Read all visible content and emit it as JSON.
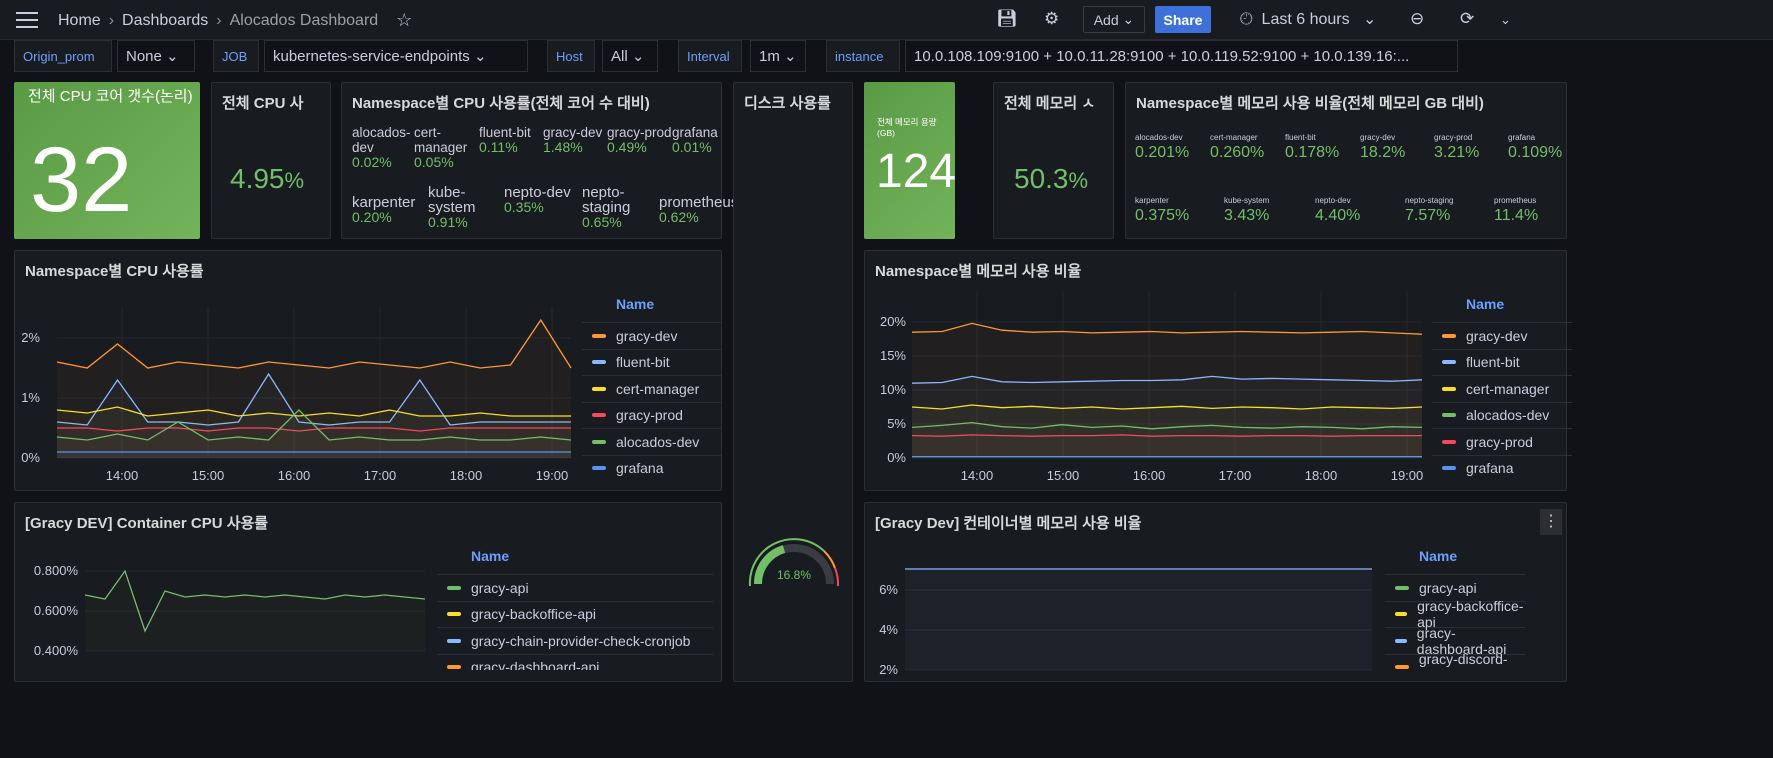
{
  "header": {
    "crumbs": [
      "Home",
      "Dashboards",
      "Alocados Dashboard"
    ],
    "add": "Add",
    "share": "Share",
    "time_range": "Last 6 hours"
  },
  "variables": [
    {
      "label": "Origin_prom",
      "value": "None"
    },
    {
      "label": "JOB",
      "value": "kubernetes-service-endpoints"
    },
    {
      "label": "Host",
      "value": "All"
    },
    {
      "label": "Interval",
      "value": "1m"
    },
    {
      "label": "instance",
      "value": "10.0.108.109:9100 + 10.0.11.28:9100 + 10.0.119.52:9100 + 10.0.139.16:..."
    }
  ],
  "stats": {
    "cpu_cores": {
      "title": "전체 CPU 코어 갯수(논리)",
      "value": "32"
    },
    "cpu_usage": {
      "title": "전체 CPU 사",
      "value": "4.95",
      "unit": "%"
    },
    "disk": {
      "title": "디스크 사용률",
      "gauge_value": "16.8%",
      "gauge_fraction": 0.168
    },
    "mem_total": {
      "title": "전체 메모리 용량 (GB)",
      "value": "124"
    },
    "mem_usage": {
      "title": "전체 메모리 ㅅ",
      "value": "50.3",
      "unit": "%"
    }
  },
  "ns_cpu": {
    "title": "Namespace별 CPU 사용률(전체 코어 수 대비)",
    "items": [
      {
        "name": "alocados-dev",
        "value": "0.02%"
      },
      {
        "name": "cert-manager",
        "value": "0.05%"
      },
      {
        "name": "fluent-bit",
        "value": "0.11%"
      },
      {
        "name": "gracy-dev",
        "value": "1.48%"
      },
      {
        "name": "gracy-prod",
        "value": "0.49%"
      },
      {
        "name": "grafana",
        "value": "0.01%"
      },
      {
        "name": "karpenter",
        "value": "0.20%"
      },
      {
        "name": "kube-system",
        "value": "0.91%"
      },
      {
        "name": "nepto-dev",
        "value": "0.35%"
      },
      {
        "name": "nepto-staging",
        "value": "0.65%"
      },
      {
        "name": "prometheus",
        "value": "0.62%"
      }
    ]
  },
  "ns_mem": {
    "title": "Namespace별 메모리 사용 비율(전체 메모리 GB 대비)",
    "items": [
      {
        "name": "alocados-dev",
        "value": "0.201%"
      },
      {
        "name": "cert-manager",
        "value": "0.260%"
      },
      {
        "name": "fluent-bit",
        "value": "0.178%"
      },
      {
        "name": "gracy-dev",
        "value": "18.2%"
      },
      {
        "name": "gracy-prod",
        "value": "3.21%"
      },
      {
        "name": "grafana",
        "value": "0.109%"
      },
      {
        "name": "karpenter",
        "value": "0.375%"
      },
      {
        "name": "kube-system",
        "value": "3.43%"
      },
      {
        "name": "nepto-dev",
        "value": "4.40%"
      },
      {
        "name": "nepto-staging",
        "value": "7.57%"
      },
      {
        "name": "prometheus",
        "value": "11.4%"
      }
    ]
  },
  "chart_data": [
    {
      "type": "line",
      "title": "Namespace별 CPU 사용률",
      "legend_header": "Name",
      "x": [
        "14:00",
        "15:00",
        "16:00",
        "17:00",
        "18:00",
        "19:00"
      ],
      "yticks": [
        "0%",
        "1%",
        "2%"
      ],
      "ylim": [
        0,
        2.2
      ],
      "series": [
        {
          "name": "gracy-dev",
          "color": "#ff9830",
          "values": [
            1.6,
            1.5,
            1.9,
            1.5,
            1.6,
            1.55,
            1.5,
            1.6,
            1.55,
            1.5,
            1.6,
            1.55,
            1.5,
            1.6,
            1.5,
            1.55,
            2.3,
            1.5
          ]
        },
        {
          "name": "fluent-bit",
          "color": "#8ab8ff",
          "values": [
            0.6,
            0.55,
            1.3,
            0.6,
            0.6,
            0.55,
            0.6,
            1.4,
            0.6,
            0.55,
            0.6,
            0.6,
            1.3,
            0.55,
            0.6,
            0.6,
            0.6,
            0.6
          ]
        },
        {
          "name": "cert-manager",
          "color": "#fade2a",
          "values": [
            0.8,
            0.75,
            0.85,
            0.7,
            0.75,
            0.8,
            0.7,
            0.75,
            0.7,
            0.75,
            0.7,
            0.8,
            0.7,
            0.7,
            0.75,
            0.7,
            0.7,
            0.7
          ]
        },
        {
          "name": "gracy-prod",
          "color": "#f2495c",
          "values": [
            0.5,
            0.5,
            0.45,
            0.5,
            0.5,
            0.45,
            0.5,
            0.5,
            0.45,
            0.5,
            0.5,
            0.5,
            0.45,
            0.5,
            0.5,
            0.5,
            0.5,
            0.5
          ]
        },
        {
          "name": "alocados-dev",
          "color": "#73bf69",
          "values": [
            0.35,
            0.3,
            0.4,
            0.3,
            0.6,
            0.3,
            0.35,
            0.3,
            0.8,
            0.3,
            0.35,
            0.3,
            0.3,
            0.35,
            0.3,
            0.3,
            0.35,
            0.3
          ]
        },
        {
          "name": "grafana",
          "color": "#5794f2",
          "values": [
            0.1,
            0.1,
            0.1,
            0.1,
            0.1,
            0.1,
            0.1,
            0.1,
            0.1,
            0.1,
            0.1,
            0.1,
            0.1,
            0.1,
            0.1,
            0.1,
            0.1,
            0.1
          ]
        }
      ]
    },
    {
      "type": "line",
      "title": "Namespace별 메모리 사용 비율",
      "legend_header": "Name",
      "x": [
        "14:00",
        "15:00",
        "16:00",
        "17:00",
        "18:00",
        "19:00"
      ],
      "yticks": [
        "0%",
        "5%",
        "10%",
        "15%",
        "20%"
      ],
      "ylim": [
        0,
        20
      ],
      "series": [
        {
          "name": "gracy-dev",
          "color": "#ff9830",
          "values": [
            18.5,
            18.6,
            19.8,
            18.8,
            18.5,
            18.6,
            18.4,
            18.5,
            18.6,
            18.4,
            18.5,
            18.6,
            18.5,
            18.4,
            18.5,
            18.6,
            18.4,
            18.2
          ]
        },
        {
          "name": "fluent-bit",
          "color": "#8ab8ff",
          "values": [
            11,
            11.1,
            12,
            11.2,
            11.1,
            11.2,
            11.3,
            11.4,
            11.4,
            11.5,
            12,
            11.6,
            11.7,
            11.6,
            11.5,
            11.4,
            11.3,
            11.5
          ]
        },
        {
          "name": "cert-manager",
          "color": "#fade2a",
          "values": [
            7.5,
            7.2,
            7.8,
            7.4,
            7.6,
            7.3,
            7.5,
            7.2,
            7.4,
            7.6,
            7.3,
            7.5,
            7.4,
            7.2,
            7.5,
            7.4,
            7.3,
            7.5
          ]
        },
        {
          "name": "alocados-dev",
          "color": "#73bf69",
          "values": [
            4.5,
            4.8,
            5.2,
            4.6,
            4.4,
            4.9,
            4.5,
            4.7,
            4.3,
            4.6,
            4.8,
            4.5,
            4.4,
            4.6,
            4.5,
            4.3,
            4.6,
            4.5
          ]
        },
        {
          "name": "gracy-prod",
          "color": "#f2495c",
          "values": [
            3.3,
            3.2,
            3.4,
            3.3,
            3.2,
            3.3,
            3.3,
            3.4,
            3.2,
            3.3,
            3.3,
            3.2,
            3.3,
            3.3,
            3.2,
            3.3,
            3.3,
            3.3
          ]
        },
        {
          "name": "grafana",
          "color": "#5794f2",
          "values": [
            0.2,
            0.2,
            0.2,
            0.2,
            0.2,
            0.2,
            0.2,
            0.2,
            0.2,
            0.2,
            0.2,
            0.2,
            0.2,
            0.2,
            0.2,
            0.2,
            0.2,
            0.2
          ]
        }
      ]
    },
    {
      "type": "line",
      "title": "[Gracy DEV] Container CPU 사용률",
      "legend_header": "Name",
      "yticks": [
        "0.400%",
        "0.600%",
        "0.800%"
      ],
      "ylim": [
        0.35,
        0.85
      ],
      "series": [
        {
          "name": "gracy-api",
          "color": "#73bf69",
          "values": [
            0.68,
            0.66,
            0.8,
            0.5,
            0.7,
            0.67,
            0.68,
            0.67,
            0.68,
            0.67,
            0.68,
            0.67,
            0.66,
            0.68,
            0.67,
            0.68,
            0.67,
            0.66
          ]
        },
        {
          "name": "gracy-backoffice-api",
          "color": "#fade2a",
          "values": []
        },
        {
          "name": "gracy-chain-provider-check-cronjob",
          "color": "#8ab8ff",
          "values": []
        },
        {
          "name": "gracy-dashboard-api",
          "color": "#ff9830",
          "values": []
        }
      ]
    },
    {
      "type": "line",
      "title": "[Gracy Dev] 컨테이너별 메모리 사용 비율",
      "legend_header": "Name",
      "yticks": [
        "2%",
        "4%",
        "6%"
      ],
      "ylim": [
        1.9,
        7.5
      ],
      "series": [
        {
          "name": "gracy-api",
          "color": "#73bf69",
          "values": []
        },
        {
          "name": "gracy-backoffice-api",
          "color": "#fade2a",
          "values": []
        },
        {
          "name": "gracy-dashboard-api",
          "color": "#8ab8ff",
          "values": [
            7.05,
            7.05,
            7.05,
            7.05,
            7.05,
            7.05
          ]
        },
        {
          "name": "gracy-discord-api",
          "color": "#ff9830",
          "values": []
        }
      ]
    }
  ]
}
